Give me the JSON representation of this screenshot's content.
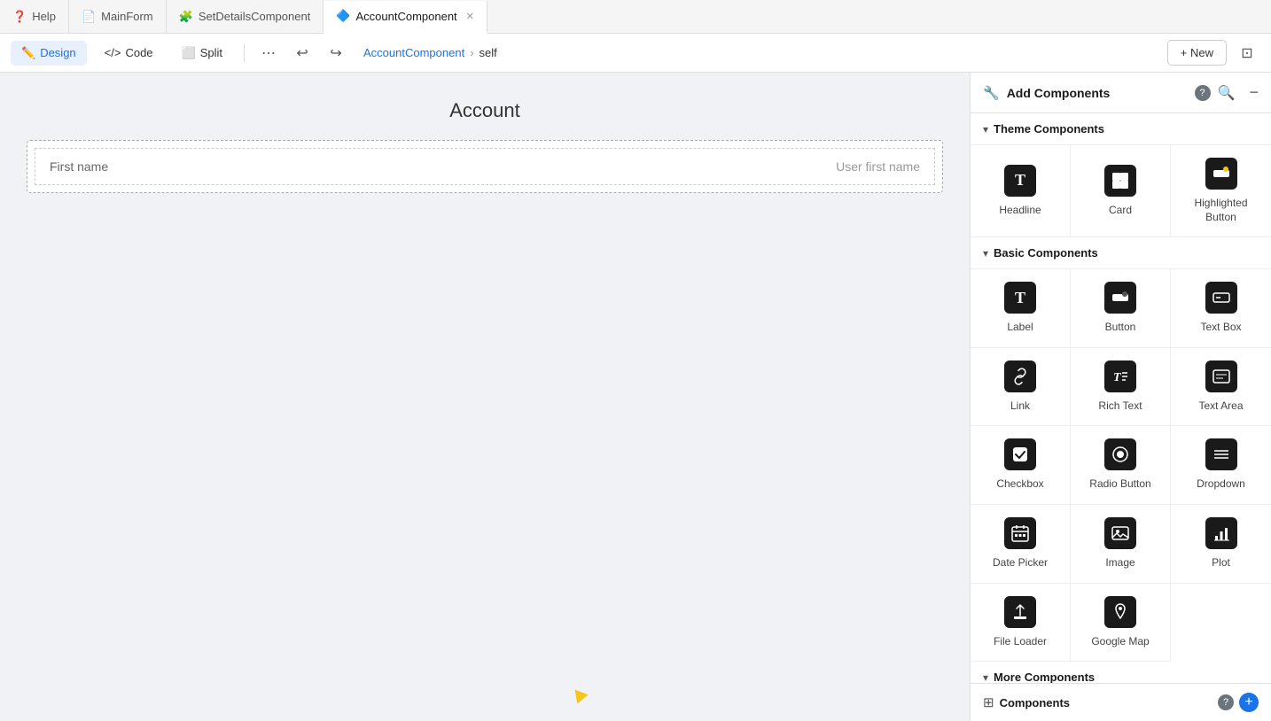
{
  "tabs": [
    {
      "id": "help",
      "icon": "❓",
      "label": "Help",
      "active": false,
      "closable": false
    },
    {
      "id": "mainform",
      "icon": "📄",
      "label": "MainForm",
      "active": false,
      "closable": false
    },
    {
      "id": "setdetails",
      "icon": "🧩",
      "label": "SetDetailsComponent",
      "active": false,
      "closable": false
    },
    {
      "id": "account",
      "icon": "🔷",
      "label": "AccountComponent",
      "active": true,
      "closable": true
    }
  ],
  "toolbar": {
    "design_label": "Design",
    "code_label": "Code",
    "split_label": "Split",
    "breadcrumb_component": "AccountComponent",
    "breadcrumb_self": "self",
    "new_label": "+ New"
  },
  "canvas": {
    "title": "Account",
    "component": {
      "label": "First name",
      "value": "User first name"
    }
  },
  "panel": {
    "title": "Add Components",
    "theme_section": "Theme Components",
    "basic_section": "Basic Components",
    "more_section": "More Components",
    "theme_components": [
      {
        "id": "headline",
        "label": "Headline",
        "icon": "T"
      },
      {
        "id": "card",
        "label": "Card",
        "icon": "⊞"
      },
      {
        "id": "highlighted-button",
        "label": "Highlighted Button",
        "icon": "👆"
      }
    ],
    "basic_components": [
      {
        "id": "label",
        "label": "Label",
        "icon": "T"
      },
      {
        "id": "button",
        "label": "Button",
        "icon": "👆"
      },
      {
        "id": "text-box",
        "label": "Text Box",
        "icon": "▭"
      },
      {
        "id": "link",
        "label": "Link",
        "icon": "🔗"
      },
      {
        "id": "rich-text",
        "label": "Rich Text",
        "icon": "T"
      },
      {
        "id": "text-area",
        "label": "Text Area",
        "icon": "▭"
      },
      {
        "id": "checkbox",
        "label": "Checkbox",
        "icon": "☑"
      },
      {
        "id": "radio-button",
        "label": "Radio Button",
        "icon": "◎"
      },
      {
        "id": "dropdown",
        "label": "Dropdown",
        "icon": "☰"
      },
      {
        "id": "date-picker",
        "label": "Date Picker",
        "icon": "📅"
      },
      {
        "id": "image",
        "label": "Image",
        "icon": "🖼"
      },
      {
        "id": "plot",
        "label": "Plot",
        "icon": "📊"
      },
      {
        "id": "file-loader",
        "label": "File Loader",
        "icon": "⬆"
      },
      {
        "id": "google-map",
        "label": "Google Map",
        "icon": "📍"
      }
    ],
    "bottom_title": "Components"
  }
}
